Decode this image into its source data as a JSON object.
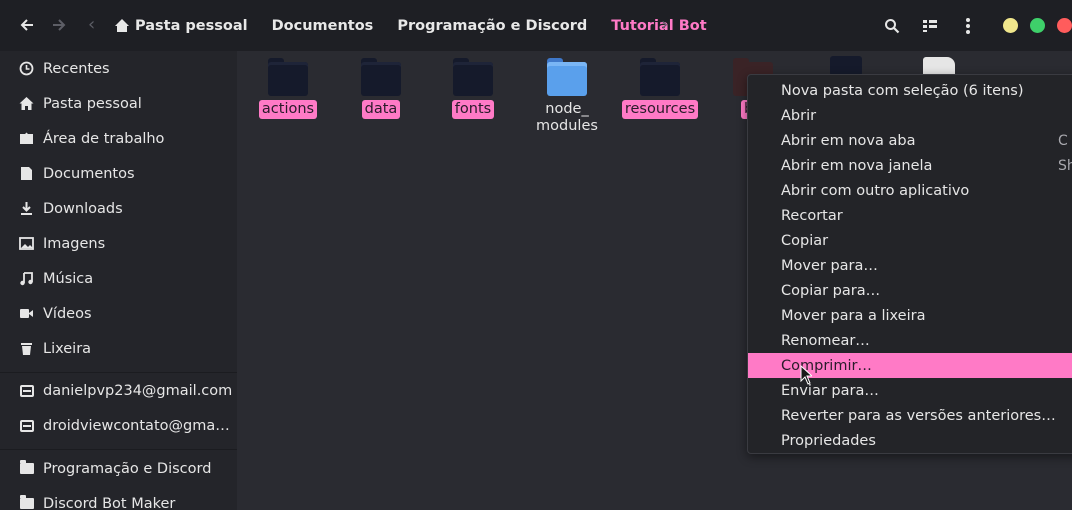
{
  "header": {
    "back_icon": "arrow-left",
    "forward_icon": "arrow-right",
    "crumbs_left_arrow": "‹",
    "crumbs_right_arrow": "›",
    "breadcrumbs": [
      "Pasta pessoal",
      "Documentos",
      "Programação e Discord",
      "Tutorial Bot"
    ],
    "search_icon": "search-icon",
    "view_icon": "list-view-icon",
    "menu_icon": "kebab-menu-icon",
    "window_controls": {
      "minimize": "#f0e68c",
      "maximize": "#3ed06a",
      "close": "#ff5c5c"
    }
  },
  "sidebar": {
    "items": [
      {
        "label": "Recentes",
        "icon": "clock-icon"
      },
      {
        "label": "Pasta pessoal",
        "icon": "home-icon"
      },
      {
        "label": "Área de trabalho",
        "icon": "desktop-icon"
      },
      {
        "label": "Documentos",
        "icon": "document-icon"
      },
      {
        "label": "Downloads",
        "icon": "download-icon"
      },
      {
        "label": "Imagens",
        "icon": "image-icon"
      },
      {
        "label": "Música",
        "icon": "music-icon"
      },
      {
        "label": "Vídeos",
        "icon": "video-icon"
      },
      {
        "label": "Lixeira",
        "icon": "trash-icon"
      }
    ],
    "accounts": [
      {
        "label": "danielpvp234@gmail.com",
        "icon": "network-drive-icon"
      },
      {
        "label": "droidviewcontato@gma…",
        "icon": "network-drive-icon"
      }
    ],
    "bookmarks": [
      {
        "label": "Programação e Discord",
        "icon": "folder-icon"
      },
      {
        "label": "Discord Bot Maker",
        "icon": "folder-icon"
      }
    ]
  },
  "files": [
    {
      "name": "actions",
      "selected": true,
      "kind": "folder-dark"
    },
    {
      "name": "data",
      "selected": true,
      "kind": "folder-dark"
    },
    {
      "name": "fonts",
      "selected": true,
      "kind": "folder-dark"
    },
    {
      "name_line1": "node_",
      "name_line2": "modules",
      "selected": false,
      "kind": "folder-blue"
    },
    {
      "name": "resources",
      "selected": true,
      "kind": "folder-dark"
    },
    {
      "name": "bo",
      "selected": true,
      "kind": "folder-brown"
    }
  ],
  "context_menu": {
    "items": [
      {
        "label": "Nova pasta com seleção (6 itens)"
      },
      {
        "label": "Abrir"
      },
      {
        "label": "Abrir em nova aba",
        "accel": "C"
      },
      {
        "label": "Abrir em nova janela",
        "accel": "Sh"
      },
      {
        "label": "Abrir com outro aplicativo"
      },
      {
        "label": "Recortar"
      },
      {
        "label": "Copiar"
      },
      {
        "label": "Mover para…"
      },
      {
        "label": "Copiar para…"
      },
      {
        "label": "Mover para a lixeira"
      },
      {
        "label": "Renomear…"
      },
      {
        "label": "Comprimir…",
        "highlighted": true
      },
      {
        "label": "Enviar para…"
      },
      {
        "label": "Reverter para as versões anteriores…"
      },
      {
        "label": "Propriedades"
      }
    ]
  },
  "accent_color": "#ff7ac6"
}
